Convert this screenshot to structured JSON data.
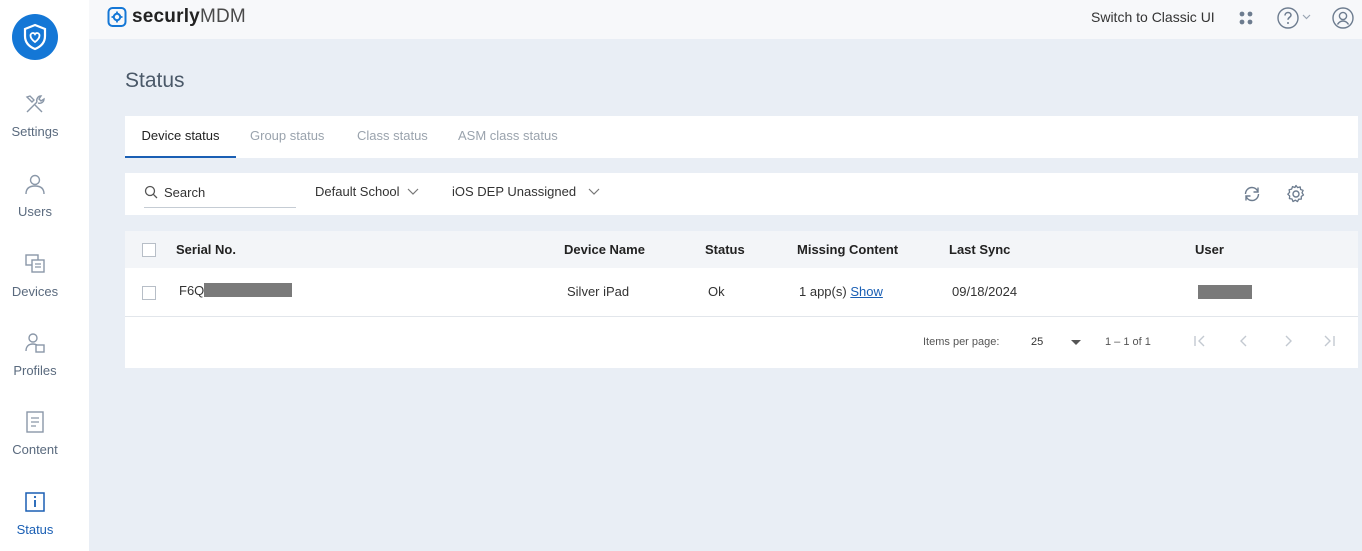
{
  "app": {
    "brand_name": "securly",
    "brand_suffix": "MDM",
    "accent_color": "#1477d6"
  },
  "topbar": {
    "switch_label": "Switch to Classic UI"
  },
  "sidebar": {
    "items": [
      {
        "label": "Settings",
        "icon": "tools-icon"
      },
      {
        "label": "Users",
        "icon": "user-icon"
      },
      {
        "label": "Devices",
        "icon": "devices-icon"
      },
      {
        "label": "Profiles",
        "icon": "profiles-icon"
      },
      {
        "label": "Content",
        "icon": "document-icon"
      },
      {
        "label": "Status",
        "icon": "info-icon",
        "active": true
      }
    ]
  },
  "page": {
    "title": "Status"
  },
  "tabs": [
    {
      "label": "Device status",
      "active": true
    },
    {
      "label": "Group status"
    },
    {
      "label": "Class status"
    },
    {
      "label": "ASM class status"
    }
  ],
  "filters": {
    "search_placeholder": "Search",
    "school_value": "Default School",
    "group_value": "iOS DEP Unassigned"
  },
  "table": {
    "columns": [
      "Serial No.",
      "Device Name",
      "Status",
      "Missing Content",
      "Last Sync",
      "User"
    ],
    "rows": [
      {
        "serial_prefix": "F6Q",
        "device_name": "Silver iPad",
        "status": "Ok",
        "missing_content": "1 app(s)",
        "missing_link": "Show",
        "last_sync": "09/18/2024"
      }
    ]
  },
  "pager": {
    "items_per_page_label": "Items per page:",
    "items_per_page_value": "25",
    "range": "1 – 1 of 1"
  }
}
